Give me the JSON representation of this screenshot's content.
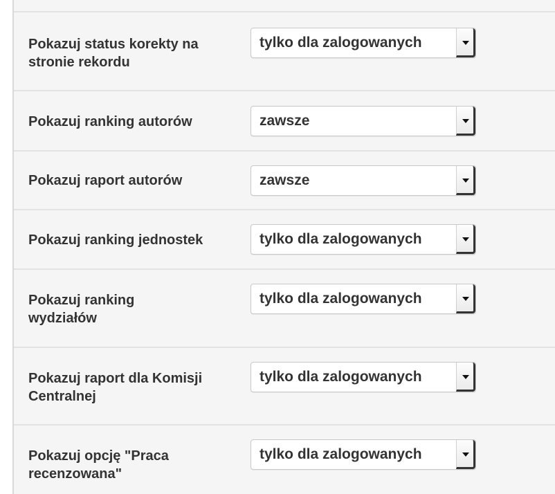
{
  "settings": {
    "rows": [
      {
        "label": "Pokazuj status korekty na stronie rekordu",
        "value": "tylko dla zalogowanych"
      },
      {
        "label": "Pokazuj ranking autorów",
        "value": "zawsze"
      },
      {
        "label": "Pokazuj raport autorów",
        "value": "zawsze"
      },
      {
        "label": "Pokazuj ranking jednostek",
        "value": "tylko dla zalogowanych"
      },
      {
        "label": "Pokazuj ranking wydziałów",
        "value": "tylko dla zalogowanych"
      },
      {
        "label": "Pokazuj raport dla Komisji Centralnej",
        "value": "tylko dla zalogowanych"
      },
      {
        "label": "Pokazuj opcję \"Praca recenzowana\"",
        "value": "tylko dla zalogowanych"
      }
    ]
  },
  "icons": {
    "dropdown": "chevron-down-icon"
  }
}
